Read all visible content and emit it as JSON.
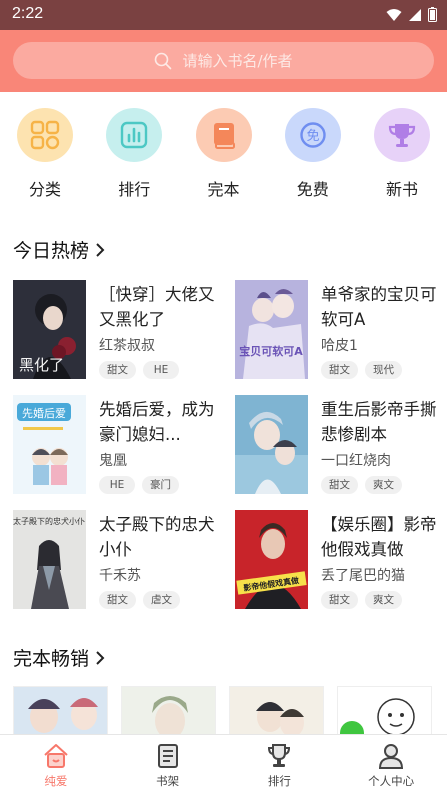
{
  "status": {
    "time": "2:22"
  },
  "search": {
    "placeholder": "请输入书名/作者"
  },
  "categories": [
    {
      "label": "分类",
      "icon": "grid-icon",
      "bg": "#fde3b0",
      "fg": "#f6b347"
    },
    {
      "label": "排行",
      "icon": "chart-icon",
      "bg": "#c6efee",
      "fg": "#4cc8c4"
    },
    {
      "label": "完本",
      "icon": "book-icon",
      "bg": "#fccbb3",
      "fg": "#f4875a"
    },
    {
      "label": "免费",
      "icon": "free-icon",
      "bg": "#c9d8fb",
      "fg": "#6f8ef0"
    },
    {
      "label": "新书",
      "icon": "trophy-icon",
      "bg": "#e7d2f8",
      "fg": "#b07ee6"
    }
  ],
  "hot": {
    "title": "今日热榜",
    "books": [
      {
        "title": "［快穿］大佬又又黑化了",
        "author": "红茶叔叔",
        "tags": [
          "甜文",
          "HE"
        ],
        "cover_bg": "#2d2f3a",
        "cover_accent": "#8a2030",
        "cover_text": "黑化了"
      },
      {
        "title": "单爷家的宝贝可软可A",
        "author": "哈皮1",
        "tags": [
          "甜文",
          "现代"
        ],
        "cover_bg": "#b7b3de",
        "cover_accent": "#6a53b6",
        "cover_text": "宝贝可软可A"
      },
      {
        "title": "先婚后爱，成为豪门媳妇...",
        "author": "鬼凰",
        "tags": [
          "HE",
          "豪门"
        ],
        "cover_bg": "#eef6fb",
        "cover_accent": "#49a9d9",
        "cover_text": "先婚后爱"
      },
      {
        "title": "重生后影帝手撕悲惨剧本",
        "author": "一口红烧肉",
        "tags": [
          "甜文",
          "爽文"
        ],
        "cover_bg": "#7fb4d2",
        "cover_accent": "#d7e8f2",
        "cover_text": ""
      },
      {
        "title": "太子殿下的忠犬小仆",
        "author": "千禾苏",
        "tags": [
          "甜文",
          "虐文"
        ],
        "cover_bg": "#e4e4e2",
        "cover_accent": "#4a4a52",
        "cover_text": "太子殿下的忠犬小仆"
      },
      {
        "title": "【娱乐圈】影帝他假戏真做",
        "author": "丢了尾巴的猫",
        "tags": [
          "甜文",
          "爽文"
        ],
        "cover_bg": "#c8242a",
        "cover_accent": "#1f1f24",
        "cover_text": "影帝他假戏真做"
      }
    ]
  },
  "finished": {
    "title": "完本畅销"
  },
  "tabs": [
    {
      "label": "纯爱",
      "icon": "house-icon",
      "active": true
    },
    {
      "label": "书架",
      "icon": "bookshelf-icon",
      "active": false
    },
    {
      "label": "排行",
      "icon": "trophy-icon",
      "active": false
    },
    {
      "label": "个人中心",
      "icon": "user-icon",
      "active": false
    }
  ],
  "colors": {
    "accent": "#f7776a",
    "header": "#f98678",
    "statusbar": "#7a4141"
  }
}
